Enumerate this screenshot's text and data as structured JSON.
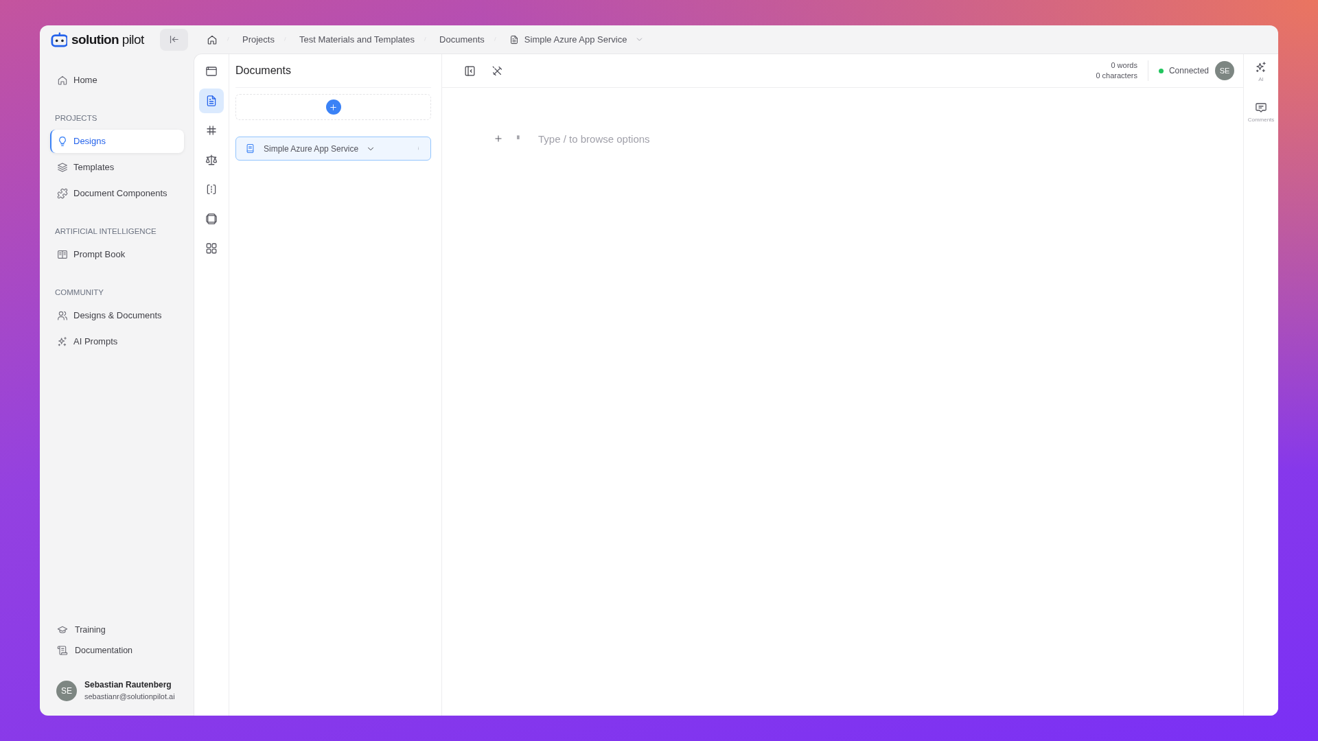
{
  "sidebar": {
    "logo": "**solution** pilot",
    "nav": [
      {
        "label": "Home",
        "selected": false
      }
    ],
    "sections": [
      {
        "heading": "PROJECTS",
        "items": [
          {
            "label": "Designs",
            "selected": true
          },
          {
            "label": "Templates",
            "selected": false
          },
          {
            "label": "Document Components",
            "selected": false
          }
        ]
      },
      {
        "heading": "ARTIFICIAL INTELLIGENCE",
        "items": [
          {
            "label": "Prompt Book",
            "selected": false
          }
        ]
      },
      {
        "heading": "COMMUNITY",
        "items": [
          {
            "label": "Designs & Documents",
            "selected": false
          },
          {
            "label": "AI Prompts",
            "selected": false
          }
        ]
      }
    ],
    "footer_items": [
      {
        "label": "Training"
      },
      {
        "label": "Documentation"
      }
    ],
    "user": {
      "initials": "SE",
      "name": "Sebastian Rautenberg",
      "email": "sebastianr@solutionpilot.ai"
    }
  },
  "breadcrumb": [
    {
      "kind": "home"
    },
    {
      "kind": "link",
      "label": "Projects"
    },
    {
      "kind": "link",
      "label": "Test Materials and Templates"
    },
    {
      "kind": "link",
      "label": "Documents"
    },
    {
      "kind": "current",
      "label": "Simple Azure App Service"
    }
  ],
  "tool_rail": [
    {
      "selected": false
    },
    {
      "selected": true
    },
    {
      "selected": false
    },
    {
      "selected": false
    },
    {
      "selected": false
    },
    {
      "selected": false
    },
    {
      "selected": false
    }
  ],
  "documents_panel": {
    "title": "Documents",
    "documents": [
      {
        "label": "Simple Azure App Service",
        "selected": true
      }
    ]
  },
  "editor": {
    "word_count": "0 words",
    "character_count": "0 characters",
    "connection": {
      "label": "Connected",
      "connected": true
    },
    "user_initials": "SE",
    "placeholder": "Type / to browse options"
  },
  "right_rail": [
    {
      "label": "AI"
    },
    {
      "label": "Comments"
    }
  ]
}
